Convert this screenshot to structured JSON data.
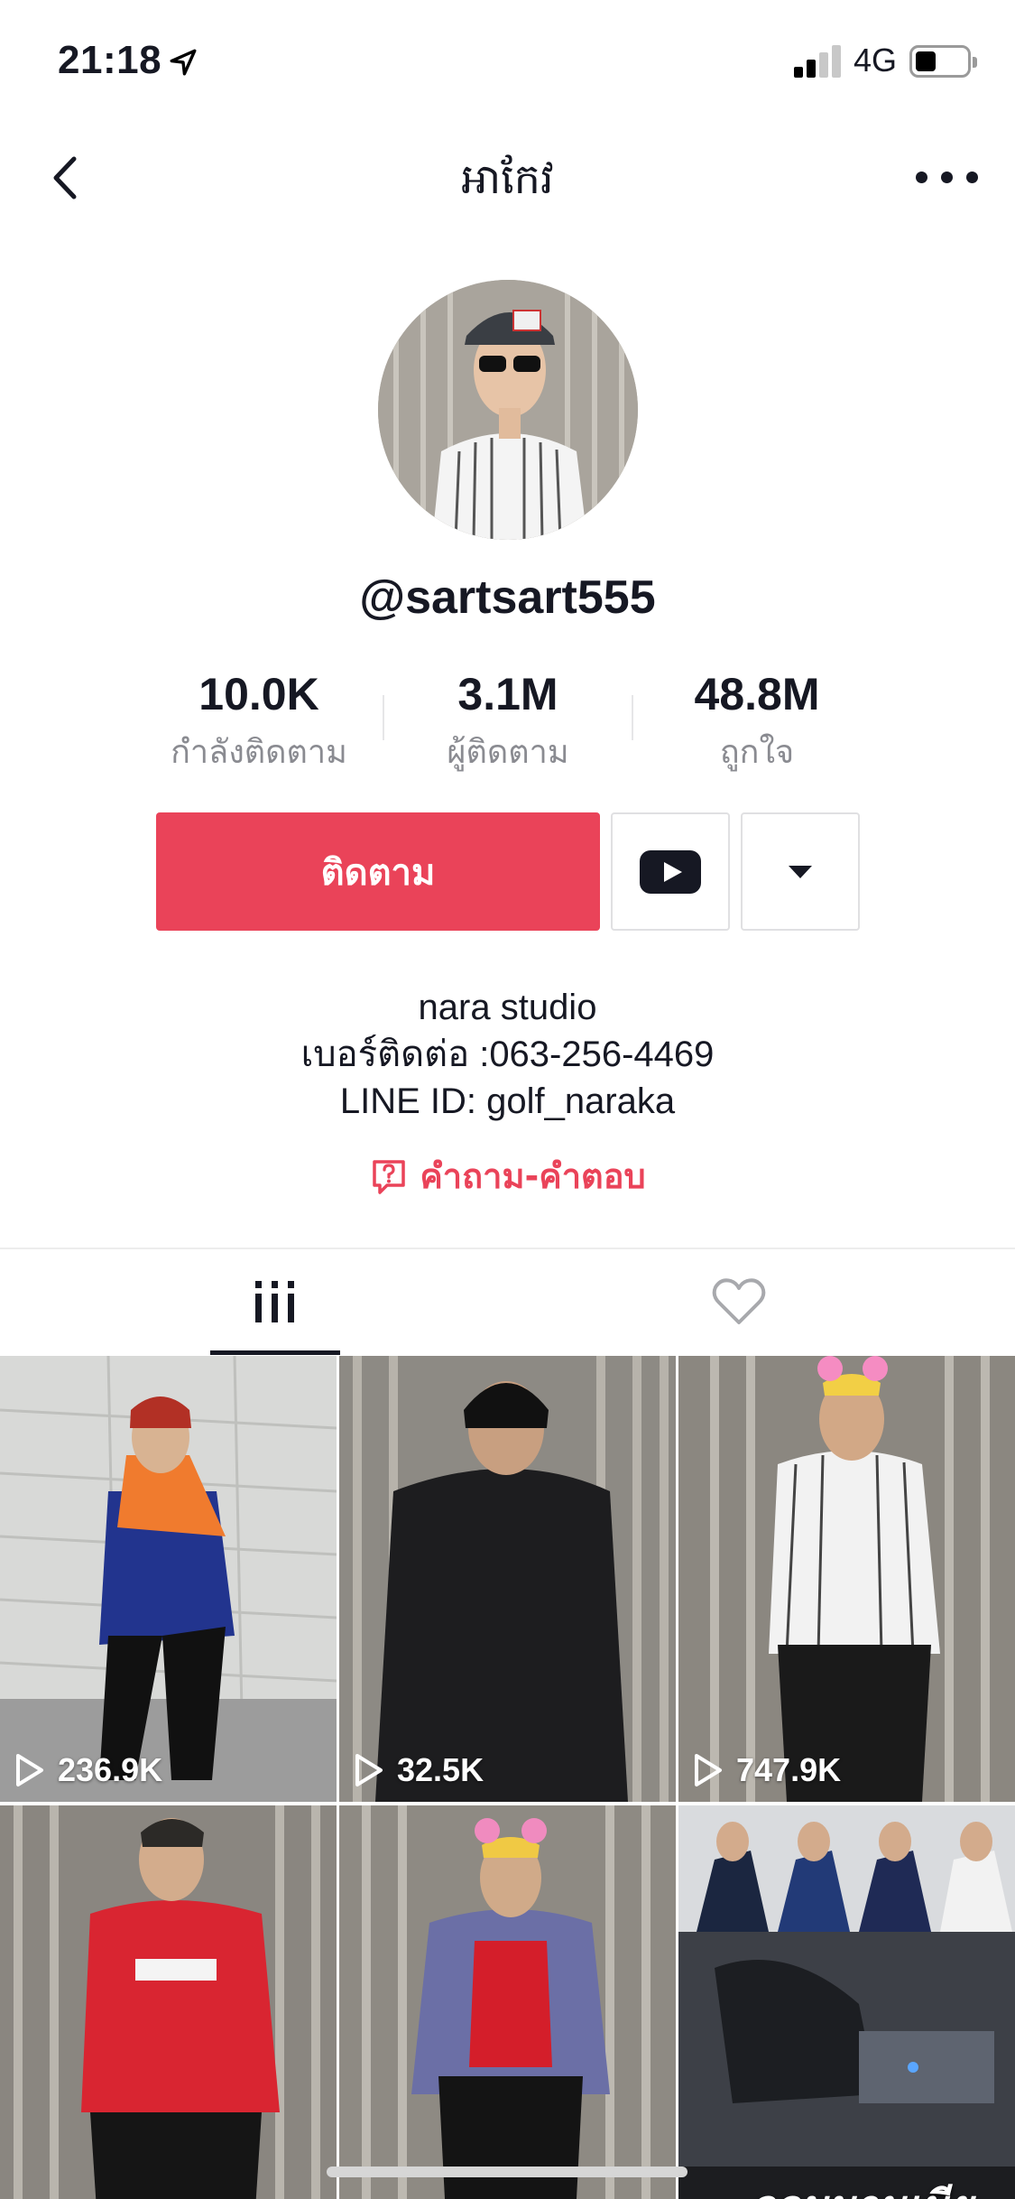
{
  "status_bar": {
    "time": "21:18",
    "network": "4G",
    "battery_level": 0.3
  },
  "nav": {
    "title": "អាកែវ",
    "back_icon": "chevron-left-icon",
    "more_icon": "ellipsis-icon"
  },
  "profile": {
    "username": "@sartsart555",
    "stats": [
      {
        "value": "10.0K",
        "label": "กำลังติดตาม"
      },
      {
        "value": "3.1M",
        "label": "ผู้ติดตาม"
      },
      {
        "value": "48.8M",
        "label": "ถูกใจ"
      }
    ]
  },
  "actions": {
    "follow_label": "ติดตาม",
    "youtube_icon": "youtube-icon",
    "dropdown_icon": "caret-down-icon"
  },
  "bio": {
    "lines": [
      "nara studio",
      "เบอร์ติดต่อ :063-256-4469",
      "LINE ID: golf_naraka"
    ],
    "qa_label": "คำถาม-คำตอบ"
  },
  "tabs": [
    {
      "icon": "videos-grid-icon",
      "active": true
    },
    {
      "icon": "heart-icon",
      "active": false
    }
  ],
  "videos": [
    {
      "views": "236.9K"
    },
    {
      "views": "32.5K"
    },
    {
      "views": "747.9K"
    },
    {
      "views": ""
    },
    {
      "views": ""
    },
    {
      "views": "",
      "caption": "จอมมานเนีย"
    }
  ],
  "colors": {
    "accent": "#ea4359",
    "text": "#161823",
    "muted": "#8a8b91"
  }
}
